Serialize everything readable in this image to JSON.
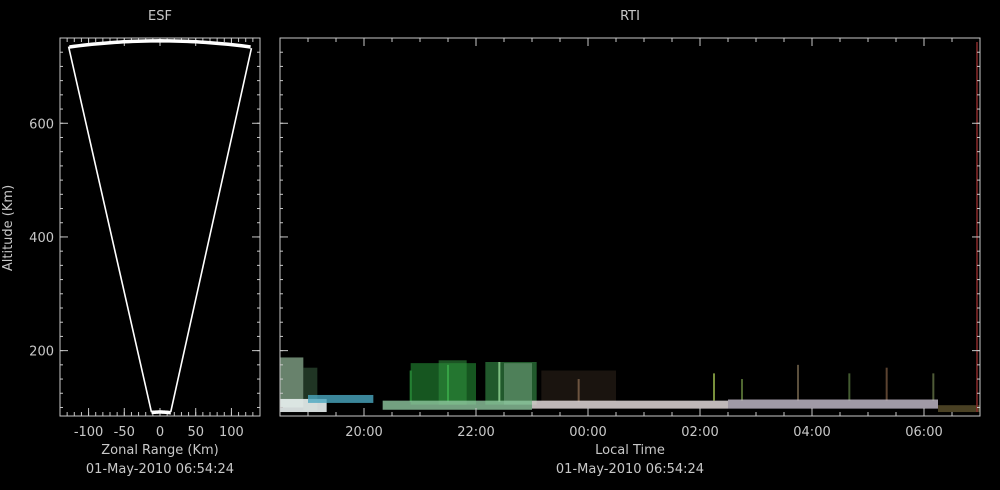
{
  "chart_data": [
    {
      "type": "line",
      "title": "ESF",
      "xlabel": "Zonal Range (Km)",
      "ylabel": "Altitude (Km)",
      "xlim": [
        -140,
        140
      ],
      "ylim": [
        85,
        750
      ],
      "x_ticks": [
        "-100",
        "-50",
        "0",
        "50",
        "100"
      ],
      "y_ticks": [
        "200",
        "400",
        "600"
      ],
      "grid": false,
      "footer": "01-May-2010 06:54:24",
      "beam_outline": [
        {
          "x": -128,
          "y": 735
        },
        {
          "x": -12,
          "y": 92
        },
        {
          "x": 15,
          "y": 92
        },
        {
          "x": 128,
          "y": 732
        }
      ],
      "outer_arc": {
        "radius_km": 745,
        "start_deg": -9.8,
        "end_deg": 9.8
      },
      "inner_arc": {
        "radius_km": 92,
        "start_deg": -7.5,
        "end_deg": 9.5
      },
      "colors": {
        "axes": "#c8c8c8",
        "beam": "#ffffff",
        "background": "#000000"
      }
    },
    {
      "type": "heatmap",
      "title": "RTI",
      "xlabel": "Local Time",
      "ylabel": "",
      "xlim": [
        "18:30",
        "07:00"
      ],
      "ylim": [
        85,
        750
      ],
      "x_ticks": [
        "20:00",
        "22:00",
        "00:00",
        "02:00",
        "04:00",
        "06:00"
      ],
      "y_ticks": [
        "200",
        "400",
        "600"
      ],
      "grid": false,
      "footer": "01-May-2010 06:54:24",
      "echo_regions": [
        {
          "t_start": "18:30",
          "t_end": "18:55",
          "alt_low": 100,
          "alt_high": 188,
          "color": "#9fc8a6",
          "intensity": 0.65
        },
        {
          "t_start": "18:55",
          "t_end": "19:10",
          "alt_low": 95,
          "alt_high": 170,
          "color": "#3f6a48",
          "intensity": 0.5
        },
        {
          "t_start": "20:50",
          "t_end": "22:00",
          "alt_low": 105,
          "alt_high": 178,
          "color": "#1f7a2e",
          "intensity": 0.7
        },
        {
          "t_start": "21:20",
          "t_end": "21:50",
          "alt_low": 105,
          "alt_high": 183,
          "color": "#2e8c3c",
          "intensity": 0.6
        },
        {
          "t_start": "22:10",
          "t_end": "23:05",
          "alt_low": 105,
          "alt_high": 180,
          "color": "#2f7f3e",
          "intensity": 0.7
        },
        {
          "t_start": "22:30",
          "t_end": "23:00",
          "alt_low": 105,
          "alt_high": 178,
          "color": "#7ba886",
          "intensity": 0.5
        },
        {
          "t_start": "23:10",
          "t_end": "00:30",
          "alt_low": 110,
          "alt_high": 165,
          "color": "#4a3a2a",
          "intensity": 0.35
        }
      ],
      "bottom_layer": [
        {
          "t_start": "18:30",
          "t_end": "19:20",
          "alt_low": 92,
          "alt_high": 115,
          "color": "#e8f0f0",
          "intensity": 0.9
        },
        {
          "t_start": "19:00",
          "t_end": "20:10",
          "alt_low": 108,
          "alt_high": 122,
          "color": "#4aa8c0",
          "intensity": 0.8
        },
        {
          "t_start": "20:20",
          "t_end": "23:00",
          "alt_low": 96,
          "alt_high": 112,
          "color": "#90c8a0",
          "intensity": 0.8
        },
        {
          "t_start": "23:00",
          "t_end": "02:30",
          "alt_low": 98,
          "alt_high": 112,
          "color": "#e0d8d8",
          "intensity": 0.85
        },
        {
          "t_start": "02:30",
          "t_end": "06:15",
          "alt_low": 98,
          "alt_high": 114,
          "color": "#c8c0d0",
          "intensity": 0.8
        },
        {
          "t_start": "06:15",
          "t_end": "07:00",
          "alt_low": 92,
          "alt_high": 104,
          "color": "#7a6a3a",
          "intensity": 0.6
        }
      ],
      "spikes": [
        {
          "t": "20:50",
          "alt_low": 110,
          "alt_high": 165,
          "color": "#2ea040"
        },
        {
          "t": "21:30",
          "alt_low": 110,
          "alt_high": 175,
          "color": "#3cb24c"
        },
        {
          "t": "22:25",
          "alt_low": 110,
          "alt_high": 180,
          "color": "#9fe09f"
        },
        {
          "t": "23:50",
          "alt_low": 110,
          "alt_high": 150,
          "color": "#8a6a50"
        },
        {
          "t": "02:15",
          "alt_low": 112,
          "alt_high": 160,
          "color": "#a0c050"
        },
        {
          "t": "02:45",
          "alt_low": 112,
          "alt_high": 150,
          "color": "#6a8a40"
        },
        {
          "t": "03:45",
          "alt_low": 112,
          "alt_high": 175,
          "color": "#7a6a50"
        },
        {
          "t": "04:40",
          "alt_low": 112,
          "alt_high": 160,
          "color": "#5a7a40"
        },
        {
          "t": "05:20",
          "alt_low": 112,
          "alt_high": 170,
          "color": "#7a5a40"
        },
        {
          "t": "06:10",
          "alt_low": 112,
          "alt_high": 160,
          "color": "#6a7a4a"
        }
      ],
      "colors": {
        "axes": "#c8c8c8",
        "right_edge": "#8a2a2a",
        "background": "#000000"
      }
    }
  ]
}
